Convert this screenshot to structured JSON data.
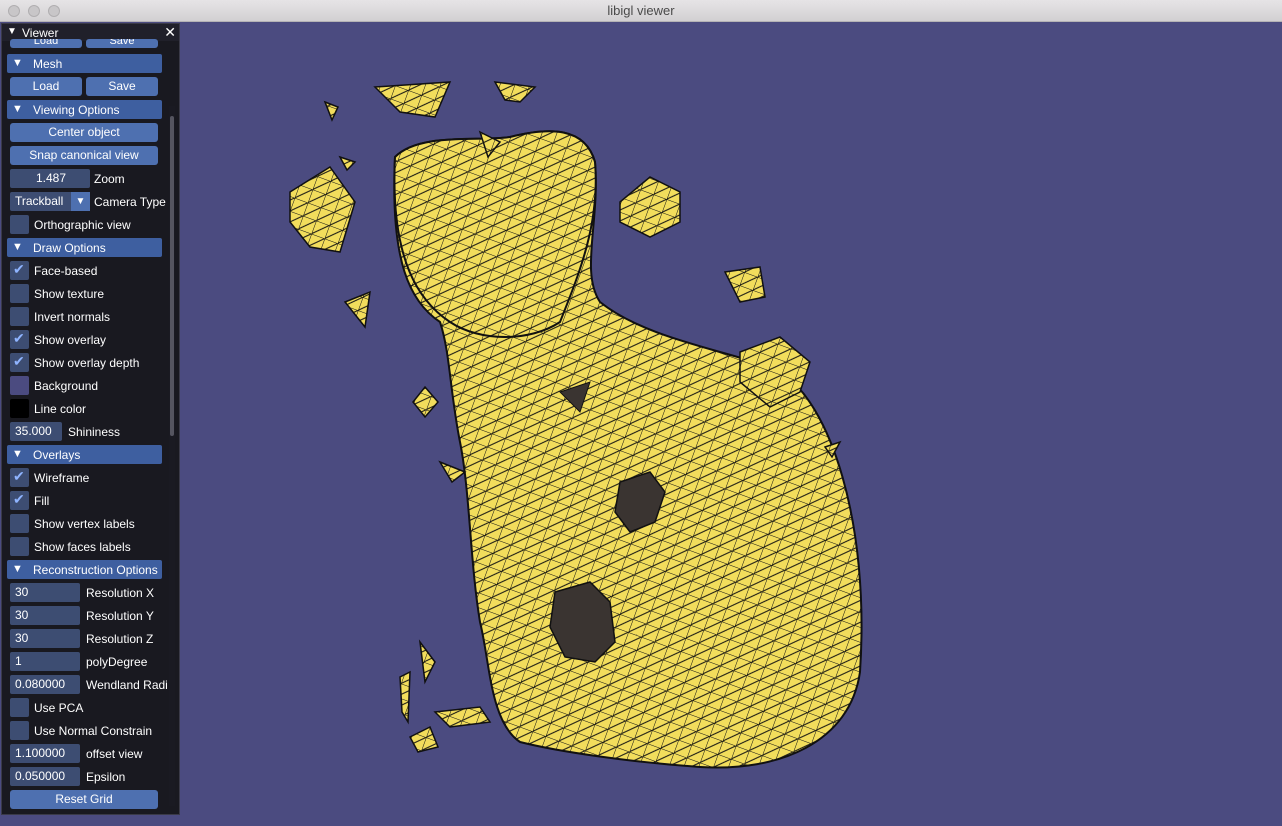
{
  "window": {
    "title": "libigl viewer"
  },
  "panel": {
    "title": "Viewer",
    "close_icon": "close-icon",
    "top_partial": {
      "load": "Load",
      "save": "Save"
    },
    "mesh": {
      "header": "Mesh",
      "load": "Load",
      "save": "Save"
    },
    "viewing": {
      "header": "Viewing Options",
      "center": "Center object",
      "snap": "Snap canonical view",
      "zoom_value": "1.487",
      "zoom_label": "Zoom",
      "camera_value": "Trackball",
      "camera_label": "Camera Type",
      "ortho_label": "Orthographic view"
    },
    "draw": {
      "header": "Draw Options",
      "items": [
        {
          "label": "Face-based",
          "checked": true
        },
        {
          "label": "Show texture",
          "checked": false
        },
        {
          "label": "Invert normals",
          "checked": false
        },
        {
          "label": "Show overlay",
          "checked": true
        },
        {
          "label": "Show overlay depth",
          "checked": true
        },
        {
          "label": "Background",
          "checked": false
        },
        {
          "label": "Line color",
          "checked": false
        }
      ],
      "shininess_value": "35.000",
      "shininess_label": "Shininess",
      "background_color": "#4b4b80",
      "line_color": "#000000"
    },
    "overlays": {
      "header": "Overlays",
      "items": [
        {
          "label": "Wireframe",
          "checked": true
        },
        {
          "label": "Fill",
          "checked": true
        },
        {
          "label": "Show vertex labels",
          "checked": false
        },
        {
          "label": "Show faces labels",
          "checked": false
        }
      ]
    },
    "recon": {
      "header": "Reconstruction Options",
      "fields": [
        {
          "value": "30",
          "label": "Resolution X"
        },
        {
          "value": "30",
          "label": "Resolution Y"
        },
        {
          "value": "30",
          "label": "Resolution Z"
        },
        {
          "value": "1",
          "label": "polyDegree"
        },
        {
          "value": "0.080000",
          "label": "Wendland Radi"
        }
      ],
      "use_pca": "Use PCA",
      "use_normal": "Use Normal Constrain",
      "offset_value": "1.100000",
      "offset_label": "offset view",
      "epsilon_value": "0.050000",
      "epsilon_label": "Epsilon",
      "reset": "Reset Grid"
    }
  },
  "colors": {
    "mesh_fill": "#f2dd5c",
    "mesh_dark": "#3a3431",
    "accent": "#4e70b0"
  }
}
